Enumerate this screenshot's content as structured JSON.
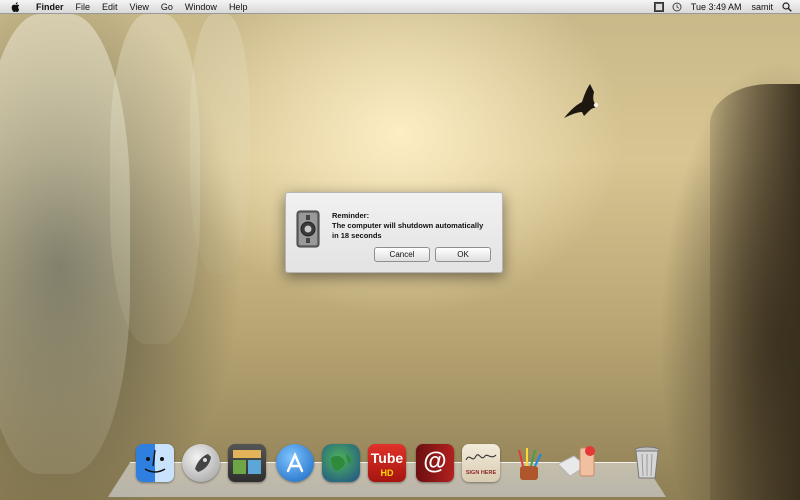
{
  "menubar": {
    "app_name": "Finder",
    "menus": [
      "File",
      "Edit",
      "View",
      "Go",
      "Window",
      "Help"
    ],
    "clock": "Tue 3:49 AM",
    "user": "samit",
    "icons": [
      "apple-icon",
      "display-icon",
      "time-machine-icon",
      "spotlight-icon"
    ]
  },
  "dialog": {
    "title": "Reminder:",
    "message": "The computer will shutdown automatically in 18 seconds",
    "cancel_label": "Cancel",
    "ok_label": "OK",
    "icon": "shutdown-app-icon"
  },
  "dock": {
    "items": [
      {
        "name": "finder",
        "icon": "finder-icon"
      },
      {
        "name": "launchpad",
        "icon": "launchpad-icon"
      },
      {
        "name": "photo-app",
        "icon": "photo-frame-icon"
      },
      {
        "name": "app-store",
        "icon": "app-store-icon"
      },
      {
        "name": "globe-app",
        "icon": "globe-icon"
      },
      {
        "name": "tube-hd",
        "icon": "tube-hd-icon",
        "text": "Tube",
        "sub": "HD"
      },
      {
        "name": "mail-app",
        "icon": "at-sign-icon",
        "text": "@"
      },
      {
        "name": "sign-here",
        "icon": "sign-here-icon",
        "text": "SIGN HERE"
      },
      {
        "name": "paint-app",
        "icon": "paint-brushes-icon"
      },
      {
        "name": "notes-app",
        "icon": "envelope-badge-icon"
      },
      {
        "name": "trash",
        "icon": "trash-icon"
      }
    ]
  },
  "colors": {
    "menubar_bg": "#e6e6e6",
    "dialog_bg": "#ececec",
    "wallpaper_light": "#e7d9ab",
    "wallpaper_dark": "#4a4430"
  }
}
